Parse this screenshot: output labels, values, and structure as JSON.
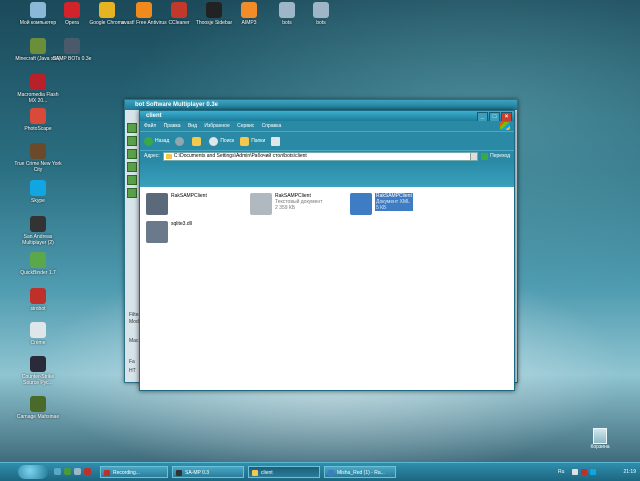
{
  "desktop": {
    "icons": [
      {
        "label": "Мой компьютер",
        "color": "#8ab8d8"
      },
      {
        "label": "Opera",
        "color": "#d2232a"
      },
      {
        "label": "Google Chrome",
        "color": "#e6b422"
      },
      {
        "label": "avast! Free Antivirus",
        "color": "#f08a1c"
      },
      {
        "label": "CCleaner",
        "color": "#c0392b"
      },
      {
        "label": "Thoosje Sidebar",
        "color": "#222222"
      },
      {
        "label": "AIMP3",
        "color": "#f28c28"
      },
      {
        "label": "bots",
        "color": "#9fb6c8"
      },
      {
        "label": "bots",
        "color": "#9fb6c8"
      },
      {
        "label": "Minecraft (Java x86)",
        "color": "#6b8e3a"
      },
      {
        "label": "SAMP BOTs 0.3e",
        "color": "#4a5a6a"
      },
      {
        "label": "Macromedia Flash MX 20...",
        "color": "#b8202a"
      },
      {
        "label": "PhotoScape",
        "color": "#d94a3a"
      },
      {
        "label": "True Crime New York City",
        "color": "#6a4a2a"
      },
      {
        "label": "Skype",
        "color": "#12a5e3"
      },
      {
        "label": "San Andreas Multiplayer (2)",
        "color": "#333333"
      },
      {
        "label": "QuickBinder 1.7",
        "color": "#5aa84a"
      },
      {
        "label": "sirobot",
        "color": "#c0302a"
      },
      {
        "label": "Crème",
        "color": "#dfe6ea"
      },
      {
        "label": "Counter-Strike Source Рус...",
        "color": "#2a2a3a"
      },
      {
        "label": "Carnage Mahsinae",
        "color": "#4a6a2a"
      }
    ],
    "recycle_label": "Корзина"
  },
  "back_window": {
    "title": "bot Software Multiplayer 0.3e",
    "stubs": [
      "Filter",
      "Mode",
      "Mac",
      "Fa",
      "HT"
    ]
  },
  "window": {
    "title": "client",
    "menu": [
      "Файл",
      "Правка",
      "Вид",
      "Избранное",
      "Сервис",
      "Справка"
    ],
    "toolbar": {
      "back": "Назад",
      "search": "Поиск",
      "folders": "Папки"
    },
    "address": {
      "label": "Адрес:",
      "path": "C:\\Documents and Settings\\Admin\\Рабочий стол\\bots\\client",
      "go": "Переход"
    },
    "files": [
      {
        "name": "RakSAMPClient",
        "sub": "",
        "selected": false,
        "color": "#5a6a7a"
      },
      {
        "name": "RakSAMPClient",
        "sub": "Текстовый документ",
        "size": "2 359 КБ",
        "selected": false,
        "color": "#b0b8c0"
      },
      {
        "name": "RakSAMPClient",
        "sub": "Документ XML",
        "size": "5 КБ",
        "selected": true,
        "color": "#3e7cc4"
      },
      {
        "name": "sqlite3.dll",
        "sub": "",
        "selected": false,
        "color": "#6a7a8a"
      }
    ]
  },
  "taskbar": {
    "tasks": [
      {
        "label": "Recording...",
        "color": "#c0302a",
        "active": false
      },
      {
        "label": "SA-MP 0.3",
        "color": "#333333",
        "active": false
      },
      {
        "label": "client",
        "color": "#f2c94c",
        "active": true
      },
      {
        "label": "Misha_Red (1) - Ra...",
        "color": "#3e7cc4",
        "active": false
      }
    ],
    "language": "Ru",
    "clock": "21:19"
  }
}
